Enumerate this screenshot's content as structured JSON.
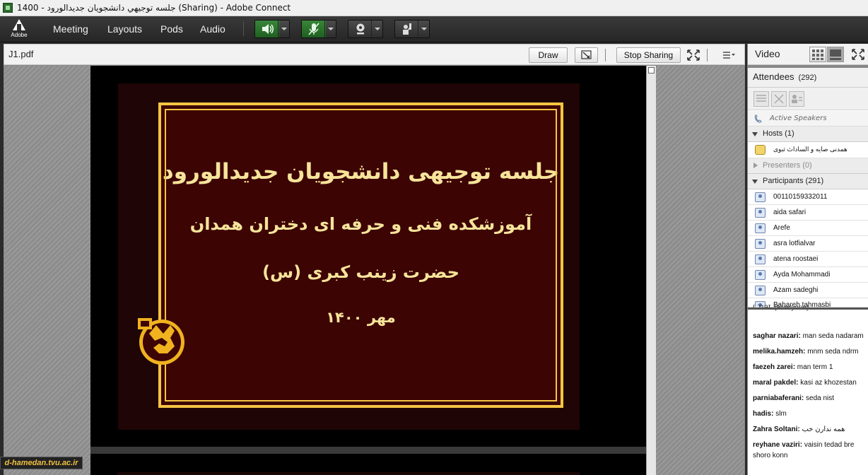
{
  "window": {
    "title": "1400 - جلسه توجيهي دانشجويان جديدالورود (Sharing) - Adobe Connect"
  },
  "menu": {
    "logo_text": "Adobe",
    "items": [
      "Meeting",
      "Layouts",
      "Pods",
      "Audio"
    ]
  },
  "toolbar": {
    "speaker_icon": "speaker-icon",
    "mic_icon": "microphone-muted-icon",
    "camera_icon": "webcam-icon",
    "raise_hand_icon": "raise-hand-icon",
    "accent_green": "#2f7a30"
  },
  "share_pod": {
    "title": "J1.pdf",
    "draw_label": "Draw",
    "stop_sharing_label": "Stop Sharing"
  },
  "slide": {
    "line1": "جلسه توجیهی دانشجویان جدیدالورود",
    "line2": "آموزشکده فنی و حرفه ای دختران همدان",
    "line3": "حضرت زینب کبری (س)",
    "line4": "مهر ۱۴۰۰",
    "frame_color": "#f5c542",
    "bg_color": "#3d0404"
  },
  "watermark": "d-hamedan.tvu.ac.ir",
  "video_pod": {
    "title": "Video"
  },
  "attendees": {
    "title": "Attendees",
    "count": "(292)",
    "active_speakers": "Active Speakers",
    "hosts_label": "Hosts (1)",
    "hosts": [
      "همدنی صایه و الساداث ثبوی"
    ],
    "presenters_label": "Presenters (0)",
    "participants_label": "Participants (291)",
    "participants": [
      "00110159332011",
      "aida safari",
      "Arefe",
      "asra lotfialvar",
      "atena roostaei",
      "Ayda Mohammadi",
      "Azam sadeghi",
      "Bahareh tahmasbi"
    ]
  },
  "chat": {
    "title": "Chat",
    "scope": "(Everyone)",
    "messages": [
      {
        "user": "saghar nazari:",
        "text": " man seda nadaram"
      },
      {
        "user": "melika.hamzeh:",
        "text": " mnm seda ndrm"
      },
      {
        "user": "faezeh zarei:",
        "text": " man term 1"
      },
      {
        "user": "maral pakdel:",
        "text": " kasi az khozestan"
      },
      {
        "user": "parniabaferani:",
        "text": "  seda nist"
      },
      {
        "user": "hadis:",
        "text": " slm"
      },
      {
        "user": "Zahra Soltani:",
        "text": " همه ندارن خب"
      },
      {
        "user": "reyhane vaziri:",
        "text": " vaisin tedad bre"
      },
      {
        "user": "",
        "text": "shoro konn"
      }
    ]
  }
}
